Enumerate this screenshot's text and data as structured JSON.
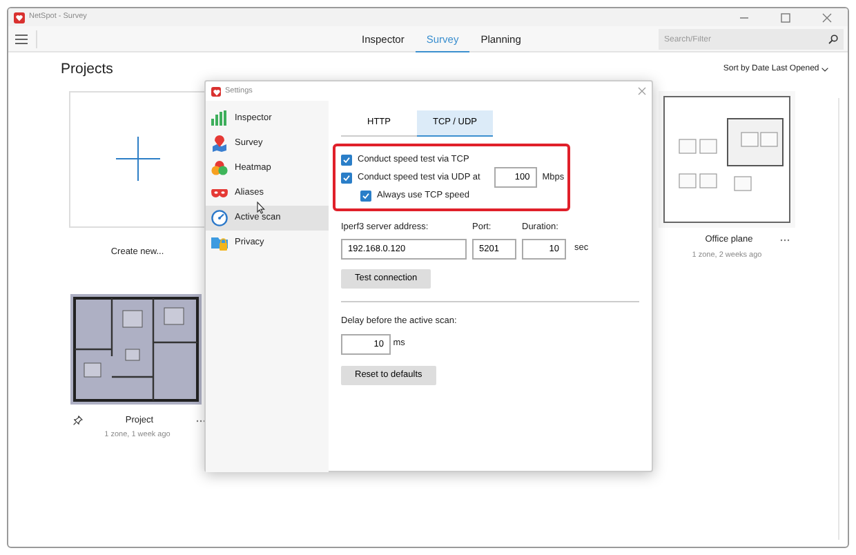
{
  "window": {
    "title": "NetSpot - Survey"
  },
  "toolbar": {
    "tabs": [
      {
        "label": "Inspector",
        "selected": false
      },
      {
        "label": "Survey",
        "selected": true
      },
      {
        "label": "Planning",
        "selected": false
      }
    ],
    "search": {
      "placeholder": "Search/Filter"
    }
  },
  "projects": {
    "heading": "Projects",
    "sort": "Sort by Date Last Opened",
    "rows": [
      [
        {
          "kind": "new",
          "title": "Create new..."
        },
        {
          "kind": "plan",
          "title": "Office plane",
          "meta": "1 zone, 2 weeks ago",
          "pin_visible": false
        }
      ],
      [
        {
          "kind": "plan",
          "title": "Project",
          "meta": "1 zone, 1 week ago",
          "pin_visible": true
        }
      ]
    ]
  },
  "settings": {
    "title": "Settings",
    "nav": [
      {
        "label": "Inspector",
        "selected": false
      },
      {
        "label": "Survey",
        "selected": false
      },
      {
        "label": "Heatmap",
        "selected": false
      },
      {
        "label": "Aliases",
        "selected": false
      },
      {
        "label": "Active scan",
        "selected": true
      },
      {
        "label": "Privacy",
        "selected": false
      }
    ],
    "tabs": [
      {
        "label": "HTTP",
        "selected": false
      },
      {
        "label": "TCP / UDP",
        "selected": true
      }
    ],
    "options": [
      {
        "label": "Conduct speed test via TCP",
        "checked": true
      },
      {
        "label": "Conduct speed test via UDP at",
        "checked": true,
        "value": "100",
        "unit": "Mbps",
        "children": [
          {
            "label": "Always use TCP speed",
            "checked": true
          }
        ]
      }
    ],
    "server": {
      "address_label": "Iperf3 server address:",
      "address": "192.168.0.120",
      "port_label": "Port:",
      "port": "5201",
      "duration_label": "Duration:",
      "duration": "10",
      "duration_unit": "sec"
    },
    "test_button": "Test connection",
    "delay": {
      "label": "Delay before the active scan:",
      "value": "10",
      "unit": "ms"
    },
    "reset_button": "Reset to defaults"
  }
}
